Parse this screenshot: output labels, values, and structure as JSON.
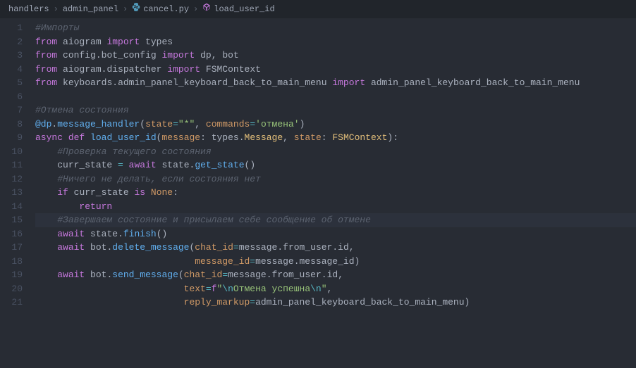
{
  "breadcrumb": {
    "folder": "handlers",
    "subfolder": "admin_panel",
    "file": "cancel.py",
    "symbol": "load_user_id"
  },
  "lines": [
    {
      "num": "1",
      "tokens": [
        {
          "cls": "comment",
          "t": "#Импорты"
        }
      ]
    },
    {
      "num": "2",
      "tokens": [
        {
          "cls": "keyword",
          "t": "from"
        },
        {
          "cls": "",
          "t": " "
        },
        {
          "cls": "module",
          "t": "aiogram"
        },
        {
          "cls": "",
          "t": " "
        },
        {
          "cls": "keyword",
          "t": "import"
        },
        {
          "cls": "",
          "t": " "
        },
        {
          "cls": "module",
          "t": "types"
        }
      ]
    },
    {
      "num": "3",
      "tokens": [
        {
          "cls": "keyword",
          "t": "from"
        },
        {
          "cls": "",
          "t": " "
        },
        {
          "cls": "module",
          "t": "config"
        },
        {
          "cls": "punct",
          "t": "."
        },
        {
          "cls": "module",
          "t": "bot_config"
        },
        {
          "cls": "",
          "t": " "
        },
        {
          "cls": "keyword",
          "t": "import"
        },
        {
          "cls": "",
          "t": " "
        },
        {
          "cls": "module",
          "t": "dp"
        },
        {
          "cls": "punct",
          "t": ", "
        },
        {
          "cls": "module",
          "t": "bot"
        }
      ]
    },
    {
      "num": "4",
      "tokens": [
        {
          "cls": "keyword",
          "t": "from"
        },
        {
          "cls": "",
          "t": " "
        },
        {
          "cls": "module",
          "t": "aiogram"
        },
        {
          "cls": "punct",
          "t": "."
        },
        {
          "cls": "module",
          "t": "dispatcher"
        },
        {
          "cls": "",
          "t": " "
        },
        {
          "cls": "keyword",
          "t": "import"
        },
        {
          "cls": "",
          "t": " "
        },
        {
          "cls": "module",
          "t": "FSMContext"
        }
      ]
    },
    {
      "num": "5",
      "tokens": [
        {
          "cls": "keyword",
          "t": "from"
        },
        {
          "cls": "",
          "t": " "
        },
        {
          "cls": "module",
          "t": "keyboards"
        },
        {
          "cls": "punct",
          "t": "."
        },
        {
          "cls": "module",
          "t": "admin_panel_keyboard_back_to_main_menu"
        },
        {
          "cls": "",
          "t": " "
        },
        {
          "cls": "keyword",
          "t": "import"
        },
        {
          "cls": "",
          "t": " "
        },
        {
          "cls": "module",
          "t": "admin_panel_keyboard_back_to_main_menu"
        }
      ]
    },
    {
      "num": "6",
      "tokens": []
    },
    {
      "num": "7",
      "tokens": [
        {
          "cls": "comment",
          "t": "#Отмена состояния"
        }
      ]
    },
    {
      "num": "8",
      "tokens": [
        {
          "cls": "decorator",
          "t": "@dp"
        },
        {
          "cls": "punct",
          "t": "."
        },
        {
          "cls": "func",
          "t": "message_handler"
        },
        {
          "cls": "punct",
          "t": "("
        },
        {
          "cls": "paramname",
          "t": "state"
        },
        {
          "cls": "op",
          "t": "="
        },
        {
          "cls": "string",
          "t": "\"*\""
        },
        {
          "cls": "punct",
          "t": ", "
        },
        {
          "cls": "paramname",
          "t": "commands"
        },
        {
          "cls": "op",
          "t": "="
        },
        {
          "cls": "string",
          "t": "'отмена'"
        },
        {
          "cls": "punct",
          "t": ")"
        }
      ]
    },
    {
      "num": "9",
      "tokens": [
        {
          "cls": "keyword",
          "t": "async"
        },
        {
          "cls": "",
          "t": " "
        },
        {
          "cls": "keyword",
          "t": "def"
        },
        {
          "cls": "",
          "t": " "
        },
        {
          "cls": "func",
          "t": "load_user_id"
        },
        {
          "cls": "punct",
          "t": "("
        },
        {
          "cls": "paramname",
          "t": "message"
        },
        {
          "cls": "punct",
          "t": ": "
        },
        {
          "cls": "module",
          "t": "types"
        },
        {
          "cls": "punct",
          "t": "."
        },
        {
          "cls": "param",
          "t": "Message"
        },
        {
          "cls": "punct",
          "t": ", "
        },
        {
          "cls": "paramname",
          "t": "state"
        },
        {
          "cls": "punct",
          "t": ": "
        },
        {
          "cls": "param",
          "t": "FSMContext"
        },
        {
          "cls": "punct",
          "t": "):"
        }
      ]
    },
    {
      "num": "10",
      "tokens": [
        {
          "cls": "",
          "t": "    "
        },
        {
          "cls": "comment",
          "t": "#Проверка текущего состояния"
        }
      ]
    },
    {
      "num": "11",
      "tokens": [
        {
          "cls": "",
          "t": "    "
        },
        {
          "cls": "module",
          "t": "curr_state"
        },
        {
          "cls": "",
          "t": " "
        },
        {
          "cls": "op",
          "t": "="
        },
        {
          "cls": "",
          "t": " "
        },
        {
          "cls": "keyword",
          "t": "await"
        },
        {
          "cls": "",
          "t": " "
        },
        {
          "cls": "module",
          "t": "state"
        },
        {
          "cls": "punct",
          "t": "."
        },
        {
          "cls": "func",
          "t": "get_state"
        },
        {
          "cls": "punct",
          "t": "()"
        }
      ]
    },
    {
      "num": "12",
      "tokens": [
        {
          "cls": "",
          "t": "    "
        },
        {
          "cls": "comment",
          "t": "#Ничего не делать, если состояния нет"
        }
      ]
    },
    {
      "num": "13",
      "tokens": [
        {
          "cls": "",
          "t": "    "
        },
        {
          "cls": "keyword",
          "t": "if"
        },
        {
          "cls": "",
          "t": " "
        },
        {
          "cls": "module",
          "t": "curr_state"
        },
        {
          "cls": "",
          "t": " "
        },
        {
          "cls": "keyword",
          "t": "is"
        },
        {
          "cls": "",
          "t": " "
        },
        {
          "cls": "const",
          "t": "None"
        },
        {
          "cls": "punct",
          "t": ":"
        }
      ]
    },
    {
      "num": "14",
      "tokens": [
        {
          "cls": "",
          "t": "        "
        },
        {
          "cls": "keyword",
          "t": "return"
        }
      ]
    },
    {
      "num": "15",
      "hl": true,
      "tokens": [
        {
          "cls": "",
          "t": "    "
        },
        {
          "cls": "comment",
          "t": "#Завершаем состояние и присылаем себе сообщение об отмене"
        }
      ]
    },
    {
      "num": "16",
      "tokens": [
        {
          "cls": "",
          "t": "    "
        },
        {
          "cls": "keyword",
          "t": "await"
        },
        {
          "cls": "",
          "t": " "
        },
        {
          "cls": "module",
          "t": "state"
        },
        {
          "cls": "punct",
          "t": "."
        },
        {
          "cls": "func",
          "t": "finish"
        },
        {
          "cls": "punct",
          "t": "()"
        }
      ]
    },
    {
      "num": "17",
      "tokens": [
        {
          "cls": "",
          "t": "    "
        },
        {
          "cls": "keyword",
          "t": "await"
        },
        {
          "cls": "",
          "t": " "
        },
        {
          "cls": "module",
          "t": "bot"
        },
        {
          "cls": "punct",
          "t": "."
        },
        {
          "cls": "func",
          "t": "delete_message"
        },
        {
          "cls": "punct",
          "t": "("
        },
        {
          "cls": "paramname",
          "t": "chat_id"
        },
        {
          "cls": "op",
          "t": "="
        },
        {
          "cls": "module",
          "t": "message"
        },
        {
          "cls": "punct",
          "t": "."
        },
        {
          "cls": "module",
          "t": "from_user"
        },
        {
          "cls": "punct",
          "t": "."
        },
        {
          "cls": "module",
          "t": "id"
        },
        {
          "cls": "punct",
          "t": ","
        }
      ]
    },
    {
      "num": "18",
      "tokens": [
        {
          "cls": "",
          "t": "                             "
        },
        {
          "cls": "paramname",
          "t": "message_id"
        },
        {
          "cls": "op",
          "t": "="
        },
        {
          "cls": "module",
          "t": "message"
        },
        {
          "cls": "punct",
          "t": "."
        },
        {
          "cls": "module",
          "t": "message_id"
        },
        {
          "cls": "punct",
          "t": ")"
        }
      ]
    },
    {
      "num": "19",
      "tokens": [
        {
          "cls": "",
          "t": "    "
        },
        {
          "cls": "keyword",
          "t": "await"
        },
        {
          "cls": "",
          "t": " "
        },
        {
          "cls": "module",
          "t": "bot"
        },
        {
          "cls": "punct",
          "t": "."
        },
        {
          "cls": "func",
          "t": "send_message"
        },
        {
          "cls": "punct",
          "t": "("
        },
        {
          "cls": "paramname",
          "t": "chat_id"
        },
        {
          "cls": "op",
          "t": "="
        },
        {
          "cls": "module",
          "t": "message"
        },
        {
          "cls": "punct",
          "t": "."
        },
        {
          "cls": "module",
          "t": "from_user"
        },
        {
          "cls": "punct",
          "t": "."
        },
        {
          "cls": "module",
          "t": "id"
        },
        {
          "cls": "punct",
          "t": ","
        }
      ]
    },
    {
      "num": "20",
      "tokens": [
        {
          "cls": "",
          "t": "                           "
        },
        {
          "cls": "paramname",
          "t": "text"
        },
        {
          "cls": "op",
          "t": "="
        },
        {
          "cls": "keyword",
          "t": "f"
        },
        {
          "cls": "string",
          "t": "\""
        },
        {
          "cls": "stresc",
          "t": "\\n"
        },
        {
          "cls": "string",
          "t": "Отмена успешна"
        },
        {
          "cls": "stresc",
          "t": "\\n"
        },
        {
          "cls": "string",
          "t": "\""
        },
        {
          "cls": "punct",
          "t": ","
        }
      ]
    },
    {
      "num": "21",
      "tokens": [
        {
          "cls": "",
          "t": "                           "
        },
        {
          "cls": "paramname",
          "t": "reply_markup"
        },
        {
          "cls": "op",
          "t": "="
        },
        {
          "cls": "module",
          "t": "admin_panel_keyboard_back_to_main_menu"
        },
        {
          "cls": "punct",
          "t": ")"
        }
      ]
    }
  ]
}
